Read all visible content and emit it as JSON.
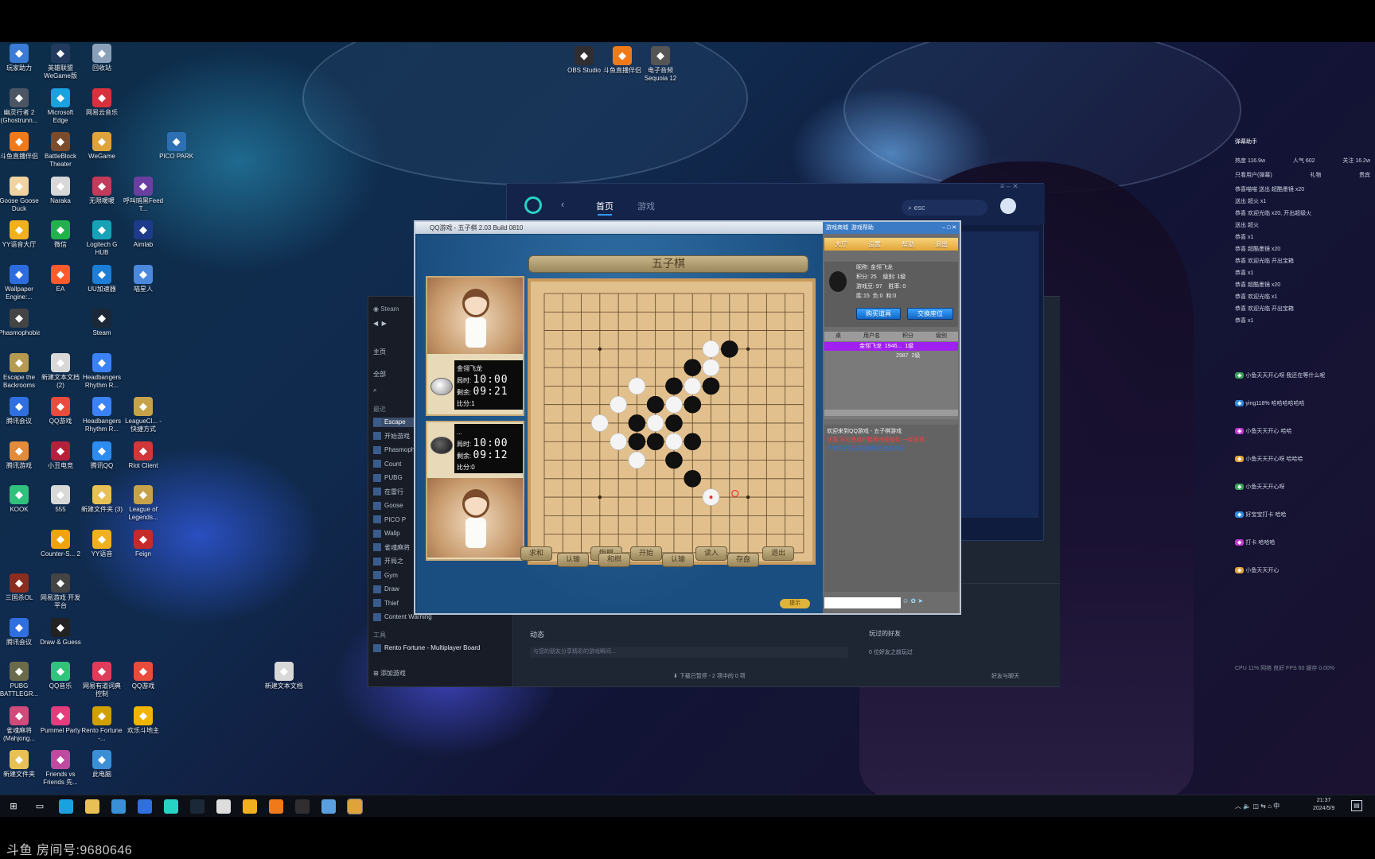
{
  "colors": {
    "accent": "#2f9cff",
    "wegame_blue": "#132349",
    "board": "#e2c08d",
    "highlight": "#a020f0"
  },
  "desktop_icons": [
    {
      "label": "玩家助力",
      "icon": "app-icon",
      "color": "#3a7bd5"
    },
    {
      "label": "英雄联盟WeGame版",
      "icon": "app-icon",
      "color": "#223a5e"
    },
    {
      "label": "回收站",
      "icon": "recycle-bin-icon",
      "color": "#8aa0b8"
    },
    {
      "label": "幽灵行者 2 (Ghostrunn...",
      "icon": "app-icon",
      "color": "#4b5563"
    },
    {
      "label": "Microsoft Edge",
      "icon": "edge-icon",
      "color": "#1aa1e0"
    },
    {
      "label": "网易云音乐",
      "icon": "netease-music-icon",
      "color": "#d9313b"
    },
    {
      "label": "斗鱼直播伴侣",
      "icon": "douyu-icon",
      "color": "#f07a1a"
    },
    {
      "label": "BattleBlock Theater",
      "icon": "app-icon",
      "color": "#7b4b2a"
    },
    {
      "label": "WeGame",
      "icon": "wegame-icon",
      "color": "#e0a33a"
    },
    {
      "label": "PICO PARK",
      "icon": "pico-park-icon",
      "color": "#2c6fb3"
    },
    {
      "label": "Goose Goose Duck",
      "icon": "app-icon",
      "color": "#f0d3a0"
    },
    {
      "label": "Naraka",
      "icon": "file-icon",
      "color": "#d8d8d8"
    },
    {
      "label": "无限暖暖",
      "icon": "app-icon",
      "color": "#c23b5a"
    },
    {
      "label": "呼叫暗黑Feed T...",
      "icon": "app-icon",
      "color": "#6b3fa0"
    },
    {
      "label": "YY语音大厅",
      "icon": "yy-icon",
      "color": "#f2b01e"
    },
    {
      "label": "微信",
      "icon": "wechat-icon",
      "color": "#22b14c"
    },
    {
      "label": "Logitech G HUB",
      "icon": "logitech-icon",
      "color": "#17a2b8"
    },
    {
      "label": "Aimlab",
      "icon": "aimlab-icon",
      "color": "#1e3a8a"
    },
    {
      "label": "Wallpaper Engine:...",
      "icon": "wallpaper-icon",
      "color": "#2d6cdf"
    },
    {
      "label": "EA",
      "icon": "ea-icon",
      "color": "#ff5a2a"
    },
    {
      "label": "UU加速器",
      "icon": "uu-icon",
      "color": "#1c7ed6"
    },
    {
      "label": "喵星人",
      "icon": "app-icon",
      "color": "#4b89dc"
    },
    {
      "label": "Phasmophobia",
      "icon": "app-icon",
      "color": "#444"
    },
    {
      "label": "Steam",
      "icon": "steam-icon",
      "color": "#1b2838"
    },
    {
      "label": "Escape the Backrooms",
      "icon": "app-icon",
      "color": "#b59a50"
    },
    {
      "label": "新建文本文档 (2)",
      "icon": "file-icon",
      "color": "#d8d8d8"
    },
    {
      "label": "Headbangers Rhythm R...",
      "icon": "app-icon",
      "color": "#3b82f6"
    },
    {
      "label": "腾讯会议",
      "icon": "tencent-meeting-icon",
      "color": "#2f6fe0"
    },
    {
      "label": "QQ游戏",
      "icon": "qq-game-icon",
      "color": "#e94b3c"
    },
    {
      "label": "Headbangers Rhythm R...",
      "icon": "app-icon",
      "color": "#3b82f6"
    },
    {
      "label": "LeagueCl... - 快捷方式",
      "icon": "app-icon",
      "color": "#c6a34a"
    },
    {
      "label": "腾讯游戏",
      "icon": "app-icon",
      "color": "#e28b3a"
    },
    {
      "label": "小丑电竞",
      "icon": "app-icon",
      "color": "#b5213a"
    },
    {
      "label": "腾讯QQ",
      "icon": "qq-icon",
      "color": "#2d8cf0"
    },
    {
      "label": "Riot Client",
      "icon": "riot-icon",
      "color": "#d13639"
    },
    {
      "label": "KOOK",
      "icon": "kook-icon",
      "color": "#30c17c"
    },
    {
      "label": "555",
      "icon": "file-icon",
      "color": "#d8d8d8"
    },
    {
      "label": "新建文件夹 (3)",
      "icon": "folder-icon",
      "color": "#e8c054"
    },
    {
      "label": "League of Legends...",
      "icon": "app-icon",
      "color": "#c6a34a"
    },
    {
      "label": "Counter-S... 2",
      "icon": "app-icon",
      "color": "#f0a30a"
    },
    {
      "label": "YY语音",
      "icon": "yy-icon",
      "color": "#f2b01e"
    },
    {
      "label": "Feign",
      "icon": "app-icon",
      "color": "#c52b2b"
    },
    {
      "label": "三国杀OL",
      "icon": "app-icon",
      "color": "#8b2e1f"
    },
    {
      "label": "网易游戏 开发平台",
      "icon": "app-icon",
      "color": "#444"
    },
    {
      "label": "腾讯会议",
      "icon": "tencent-meeting-icon",
      "color": "#2f6fe0"
    },
    {
      "label": "Draw & Guess",
      "icon": "app-icon",
      "color": "#222"
    },
    {
      "label": "PUBG BATTLEGR...",
      "icon": "pubg-icon",
      "color": "#6b6b4b"
    },
    {
      "label": "QQ音乐",
      "icon": "qq-music-icon",
      "color": "#31c27c"
    },
    {
      "label": "网易有道词典控制",
      "icon": "app-icon",
      "color": "#e13c5a"
    },
    {
      "label": "QQ游戏",
      "icon": "qq-game-icon",
      "color": "#e94b3c"
    },
    {
      "label": "新建文本文档",
      "icon": "file-icon",
      "color": "#d8d8d8"
    },
    {
      "label": "雀魂麻将 (Mahjong...",
      "icon": "app-icon",
      "color": "#d04a7a"
    },
    {
      "label": "Pummel Party",
      "icon": "app-icon",
      "color": "#e53c7d"
    },
    {
      "label": "Rento Fortune -...",
      "icon": "app-icon",
      "color": "#d0a000"
    },
    {
      "label": "欢乐斗地主",
      "icon": "app-icon",
      "color": "#f0b400"
    },
    {
      "label": "新建文件夹",
      "icon": "folder-icon",
      "color": "#e8c054"
    },
    {
      "label": "Friends vs Friends 先...",
      "icon": "app-icon",
      "color": "#c04aa0"
    },
    {
      "label": "此电脑",
      "icon": "computer-icon",
      "color": "#3a8fd6"
    },
    {
      "label": "OBS Studio",
      "icon": "obs-icon",
      "color": "#302e31"
    },
    {
      "label": "斗鱼直播伴侣",
      "icon": "douyu-icon",
      "color": "#f07a1a"
    },
    {
      "label": "电子音频 Sequoia 12",
      "icon": "app-icon",
      "color": "#555"
    }
  ],
  "steam": {
    "title": "Steam",
    "nav_home": "主页",
    "all_label": "全部",
    "recent_label": "最近",
    "games": [
      "Escape",
      "开始游戏",
      "Phasmophobia",
      "Count",
      "PUBG",
      "在雷行",
      "Goose",
      "PICO P",
      "Wallp",
      "雀魂麻将",
      "开局之",
      "Gym",
      "Draw",
      "Thief",
      "Content Warning"
    ],
    "section2": "工具",
    "tool_game": "Rento Fortune - Multiplayer Board",
    "dynamic": "动态",
    "dynamic_hint": "与您的朋友分享精彩的游戏瞬间...",
    "friends_played": "玩过的好友",
    "friends_hint": "0 位好友之前玩过",
    "add_game": "添加游戏",
    "downloads": "下载已暂停 - 2 项中的 0 项",
    "friends_chat": "好友与聊天"
  },
  "wegame": {
    "tab_home": "首页",
    "tab_games": "游戏",
    "search_placeholder": "esc"
  },
  "gomoku": {
    "window_title": "QQ游戏 - 五子棋   2.03 Build 0810",
    "board_title": "五子棋",
    "player_top": {
      "name": "金翎飞龙",
      "step_time_label": "局时:",
      "step_time": "10:00",
      "move_time_label": "剩余:",
      "move_time": "09:21",
      "score_label": "比分:",
      "score": "1"
    },
    "player_bottom": {
      "name": "...",
      "step_time_label": "局时:",
      "step_time": "10:00",
      "move_time_label": "剩余:",
      "move_time": "09:12",
      "score_label": "比分:",
      "score": "0"
    },
    "bottom_buttons": [
      "求和",
      "认输",
      "悔棋",
      "和棋",
      "开始",
      "认输",
      "读入",
      "存盘",
      "退出"
    ],
    "corner_badge": "提示",
    "right_tabs": [
      "大厅",
      "设置",
      "帮助",
      "退出"
    ],
    "top_links": [
      "游戏商城",
      "游戏帮助"
    ],
    "info": {
      "name_label": "昵称:",
      "name": "金翎飞龙",
      "points_label": "积分:",
      "points": "25",
      "level_label": "级别:",
      "level": "1级",
      "money_label": "游戏豆:",
      "money": "97",
      "win_rate_label": "胜率:",
      "win_rate": "0",
      "win_label": "胜:",
      "win": "15",
      "lose_label": "负:",
      "lose": "0",
      "draw_label": "和:",
      "draw": "0"
    },
    "info_buttons": [
      "购买道具",
      "交换座位"
    ],
    "list_headers": [
      "桌",
      "用户名",
      "积分",
      "级别"
    ],
    "list_rows": [
      {
        "name": "金翎飞龙",
        "id": "1946...",
        "level": "1级"
      },
      {
        "name": "",
        "id": "2987",
        "level": "2级"
      }
    ],
    "chat_welcome": "欢迎来到QQ游戏 - 五子棋游戏",
    "chat_line2": "注意:不可使用外挂等违规软件,一经发现",
    "chat_line3": "严禁任何形式的赌博及违规内容"
  },
  "danmaku": {
    "header": "弹幕助手",
    "stats": [
      "热度 116.9w",
      "人气 602",
      "关注 16.2w"
    ],
    "filters": [
      "只看用户(弹幕)",
      "礼物",
      "贵宾"
    ],
    "lines": [
      "恭喜喵喵 送出 超酷墨镜 x20",
      "送出 超火 x1",
      "恭喜 欢迎光临 x20, 开出超级火",
      "送出 超火",
      "恭喜 x1",
      "恭喜 超酷墨镜 x20",
      "恭喜 欢迎光临 开出宝箱",
      "恭喜 x1",
      "恭喜 超酷墨镜 x20",
      "恭喜 欢迎光临 x1",
      "恭喜 欢迎光临 开出宝箱",
      "恭喜 x1"
    ],
    "chat": [
      "小鱼天天开心呀 我还在等什么呢",
      "ying118% 哈哈哈哈哈哈",
      "小鱼天天开心 哈哈",
      "小鱼天天开心呀 哈哈哈",
      "小鱼天天开心呀",
      "好宝宝打卡 哈哈",
      "打卡 哈哈哈",
      "小鱼天天开心"
    ],
    "footer": "CPU 11%  网络 良好  FPS 60  缓存 0.00%"
  },
  "taskbar": {
    "time": "21:37",
    "date": "2024/5/9",
    "lang": "中"
  },
  "room_label": "斗鱼 房间号:9680646"
}
